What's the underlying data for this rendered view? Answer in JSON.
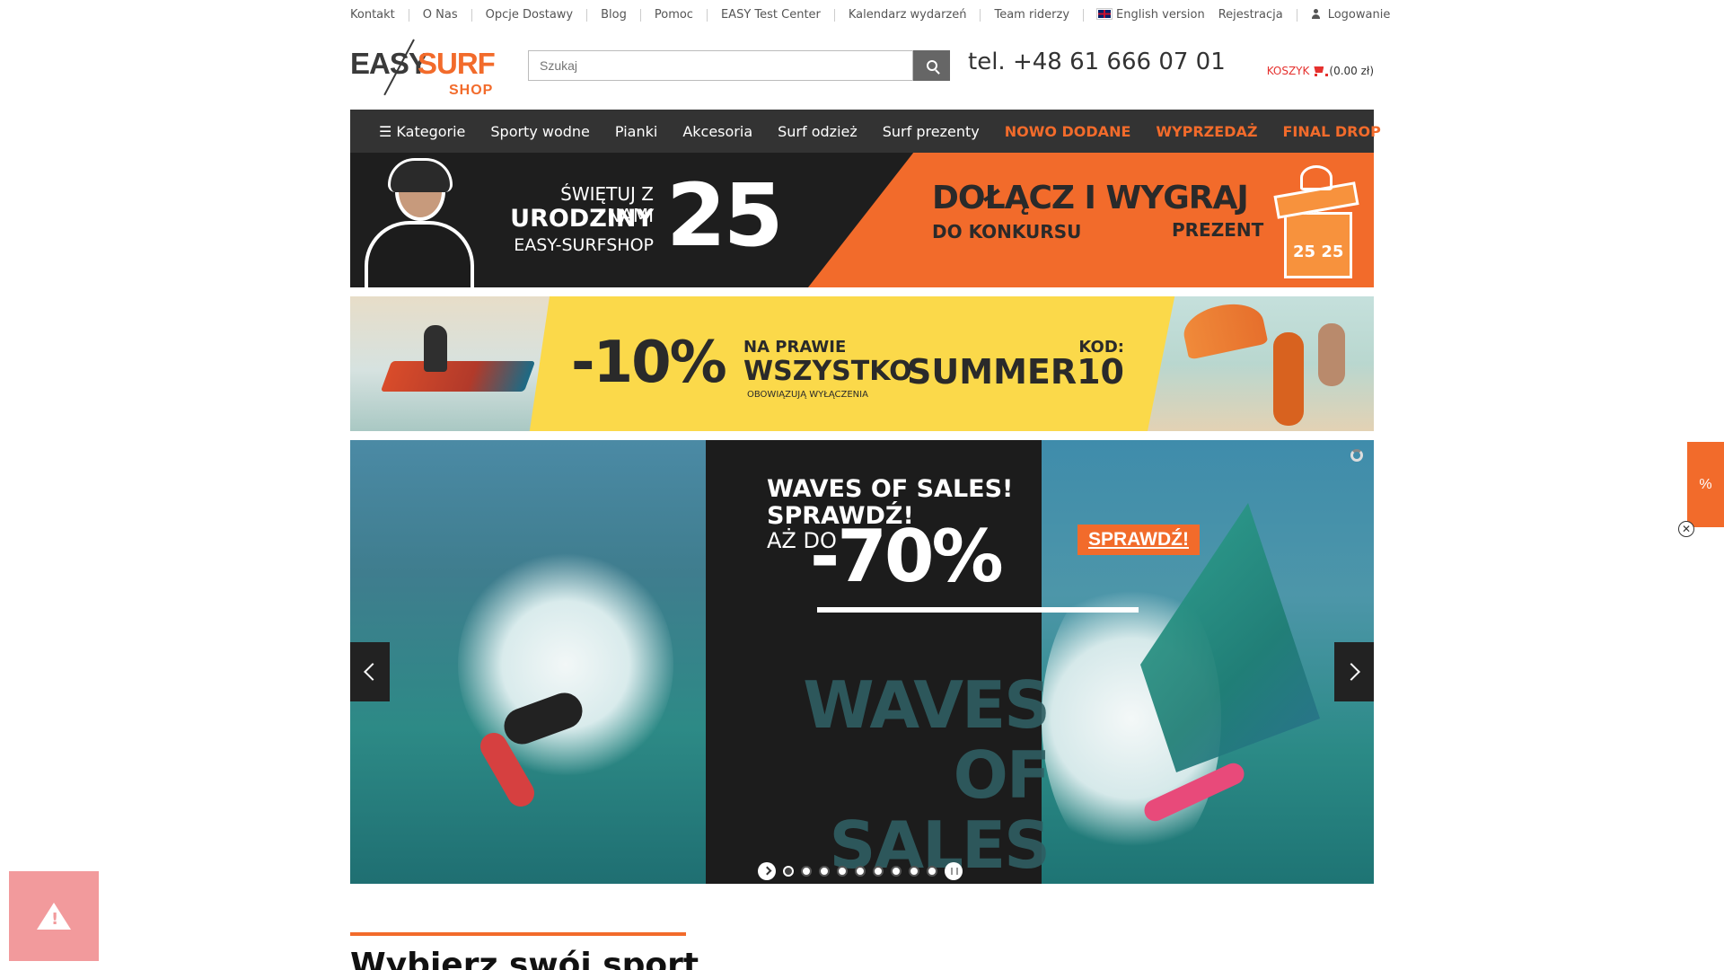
{
  "top_links": {
    "left": [
      "Kontakt",
      "O Nas",
      "Opcje Dostawy",
      "Blog",
      "Pomoc",
      "EASY Test Center",
      "Kalendarz wydarzeń",
      "Team riderzy",
      "English version"
    ],
    "right": [
      "Rejestracja",
      "Logowanie"
    ]
  },
  "header": {
    "logo": {
      "easy": "EASY",
      "surf": "SURF",
      "shop": "SHOP"
    },
    "search_placeholder": "Szukaj",
    "phone": "tel. +48 61 666 07 01",
    "cart_label": "KOSZYK",
    "cart_amount": "(0.00 zł)"
  },
  "nav": {
    "items": [
      "☰ Kategorie",
      "Sporty wodne",
      "Pianki",
      "Akcesoria",
      "Surf odzież",
      "Surf prezenty"
    ],
    "highlight_items": [
      "NOWO DODANE",
      "WYPRZEDAŻ",
      "FINAL DROP"
    ]
  },
  "banner_birthday": {
    "line1": "ŚWIĘTUJ Z NAMI",
    "line2": "URODZINY",
    "line3": "EASY-SURFSHOP",
    "number": "25",
    "join": "DOŁĄCZ I WYGRAJ",
    "contest": "DO KONKURSU",
    "prize": "PREZENT",
    "gift_number": "25 25"
  },
  "banner_summer": {
    "discount": "-10%",
    "line1": "NA PRAWIE",
    "line2": "WSZYSTKO",
    "note": "OBOWIĄZUJĄ WYŁĄCZENIA",
    "code_label": "KOD:",
    "code": "SUMMER10"
  },
  "slider": {
    "headline": "WAVES OF SALES! SPRAWDŹ!",
    "upto": "AŻ DO",
    "discount": "-70%",
    "cta": "SPRAWDŹ!",
    "watermark": "WAVES OF SALES",
    "slide_count": 9,
    "active_slide": 1
  },
  "section": {
    "title": "Wybierz swój sport"
  },
  "side": {
    "promo_tab": "%",
    "close": "✕"
  },
  "colors": {
    "accent": "#f26b2b",
    "nav_bg": "#333333",
    "cart_red": "#e5312e",
    "banner_yellow": "#fbd94a"
  },
  "icons": [
    "search-icon",
    "cart-icon",
    "user-icon",
    "uk-flag-icon",
    "chevron-left-icon",
    "chevron-right-icon",
    "play-icon",
    "pause-icon",
    "loader-icon",
    "warning-icon",
    "close-icon"
  ]
}
